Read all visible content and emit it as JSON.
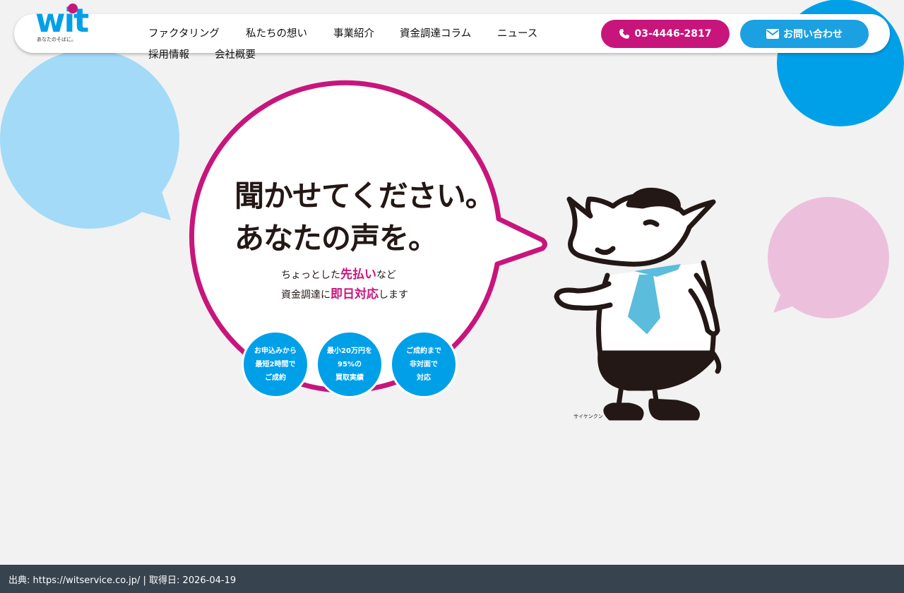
{
  "logo": {
    "word": "wit",
    "tagline": "あなたのそばに。"
  },
  "nav": {
    "items": [
      {
        "label": "ファクタリング"
      },
      {
        "label": "私たちの想い"
      },
      {
        "label": "事業紹介"
      },
      {
        "label": "資金調達コラム"
      },
      {
        "label": "ニュース"
      },
      {
        "label": "採用情報"
      },
      {
        "label": "会社概要"
      }
    ]
  },
  "cta": {
    "phone_label": "03-4446-2817",
    "contact_label": "お問い合わせ"
  },
  "hero": {
    "title_line1": "聞かせてください。",
    "title_line2": "あなたの声を。",
    "sub1_pre": "ちょっとした",
    "sub1_highlight": "先払い",
    "sub1_post": "など",
    "sub2_pre": "資金調達に",
    "sub2_highlight": "即日対応",
    "sub2_post": "します"
  },
  "features": [
    {
      "lines": [
        "お申込みから",
        "最短2時間で",
        "ご成約"
      ]
    },
    {
      "lines": [
        "最小20万円を",
        "95%の",
        "買取実績"
      ]
    },
    {
      "lines": [
        "ご成約まで",
        "非対面で",
        "対応"
      ]
    }
  ],
  "mascot": {
    "label": "サイケンクン"
  },
  "footer": {
    "text": "出典: https://witservice.co.jp/ | 取得日: 2026-04-19"
  },
  "colors": {
    "brand_blue": "#00a0e9",
    "brand_magenta": "#c8157c",
    "light_blue": "#a3daf8",
    "light_pink": "#ecc0dc",
    "background": "#f2f2f2",
    "footer_bg": "#37434f"
  },
  "icons": {
    "phone": "phone-icon",
    "mail": "envelope-icon"
  }
}
